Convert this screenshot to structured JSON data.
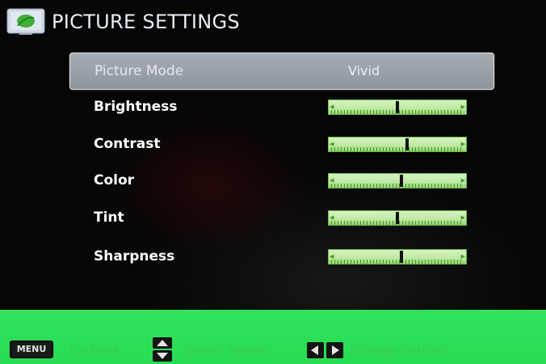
{
  "header": {
    "title": "PICTURE SETTINGS",
    "icon": "tv-leaf-icon"
  },
  "settings": [
    {
      "label": "Picture Mode",
      "value": "Vivid"
    },
    {
      "label": "Brightness",
      "level": 0.5
    },
    {
      "label": "Contrast",
      "level": 0.58
    },
    {
      "label": "Color",
      "level": 0.53
    },
    {
      "label": "Tint",
      "level": 0.5
    },
    {
      "label": "Sharpness",
      "level": 0.53
    }
  ],
  "footer": {
    "menu_key": "MENU",
    "go_back": "Go Back",
    "select_option": "Select Option",
    "change_setting": "Change Setting",
    "icons": [
      "menu-key-icon",
      "up-down-arrows-icon",
      "left-right-arrows-icon"
    ]
  },
  "colors": {
    "background": "#060606",
    "selected_row": "#9aa1a8",
    "slider_fill": "#bde8a2",
    "footer_bar": "#2ddf58",
    "footer_text": "#3ecb4e"
  }
}
